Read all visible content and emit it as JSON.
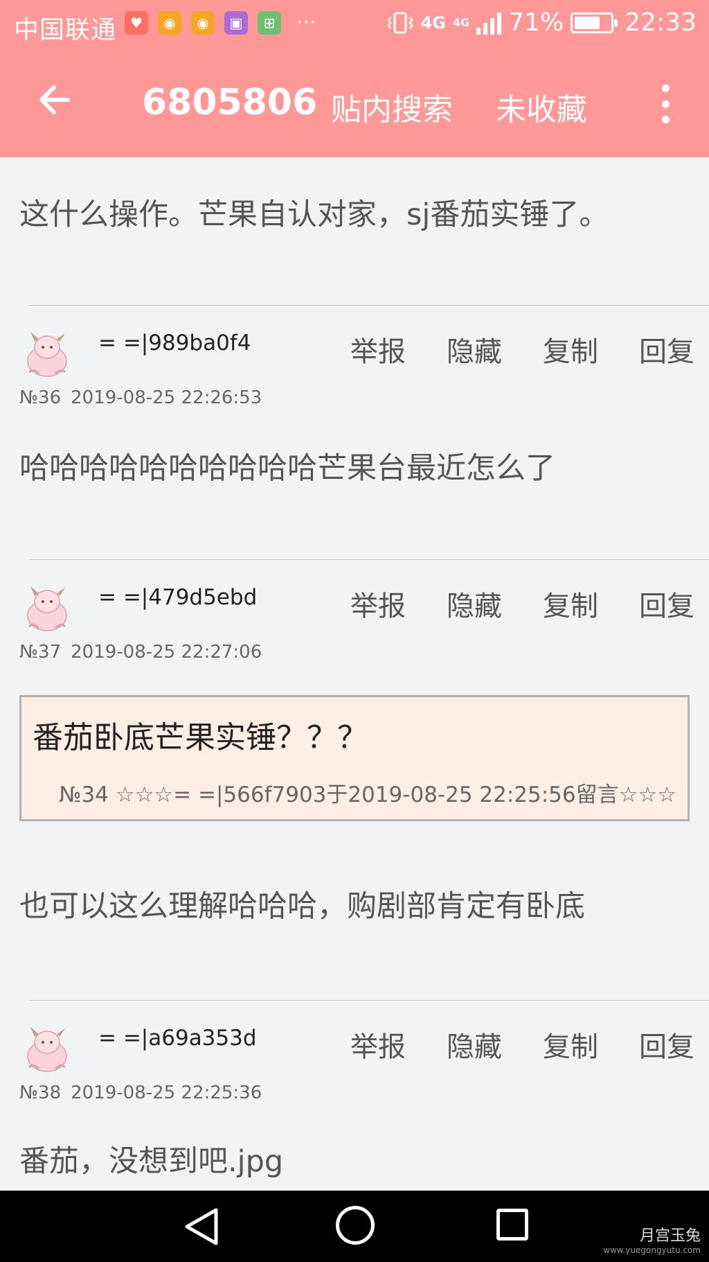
{
  "status_bar": {
    "carrier": "中国联通",
    "network_primary": "4G",
    "network_secondary": "4G",
    "battery_text": "71%",
    "battery_level": 0.71,
    "time": "22:33",
    "more": "···",
    "icons": [
      "health-app-icon",
      "weibo-icon",
      "weibo-icon",
      "gallery-icon",
      "app-grid-icon"
    ]
  },
  "title_bar": {
    "thread_id": "6805806",
    "search_label": "贴内搜索",
    "favorite_label": "未收藏"
  },
  "colors": {
    "header": "#ff9896",
    "background": "#f2f3f5",
    "quote_background": "#ffeee3"
  },
  "posts": [
    {
      "body": "这什么操作。芒果自认对家，sj番茄实锤了。"
    },
    {
      "username": "= =|989ba0f4",
      "number": "№36",
      "timestamp": "2019-08-25 22:26:53",
      "actions": [
        "举报",
        "隐藏",
        "复制",
        "回复"
      ],
      "body": "哈哈哈哈哈哈哈哈哈哈芒果台最近怎么了"
    },
    {
      "username": "= =|479d5ebd",
      "number": "№37",
      "timestamp": "2019-08-25 22:27:06",
      "actions": [
        "举报",
        "隐藏",
        "复制",
        "回复"
      ],
      "quote": {
        "text": "番茄卧底芒果实锤？？？",
        "meta": "№34 ☆☆☆= =|566f7903于2019-08-25 22:25:56留言☆☆☆"
      },
      "body": "也可以这么理解哈哈哈，购剧部肯定有卧底"
    },
    {
      "username": "= =|a69a353d",
      "number": "№38",
      "timestamp": "2019-08-25 22:25:36",
      "actions": [
        "举报",
        "隐藏",
        "复制",
        "回复"
      ],
      "body": "番茄，没想到吧.jpg"
    }
  ],
  "watermark": {
    "logo": "月宫玉兔",
    "url": "www.yuegongyutu.com"
  }
}
